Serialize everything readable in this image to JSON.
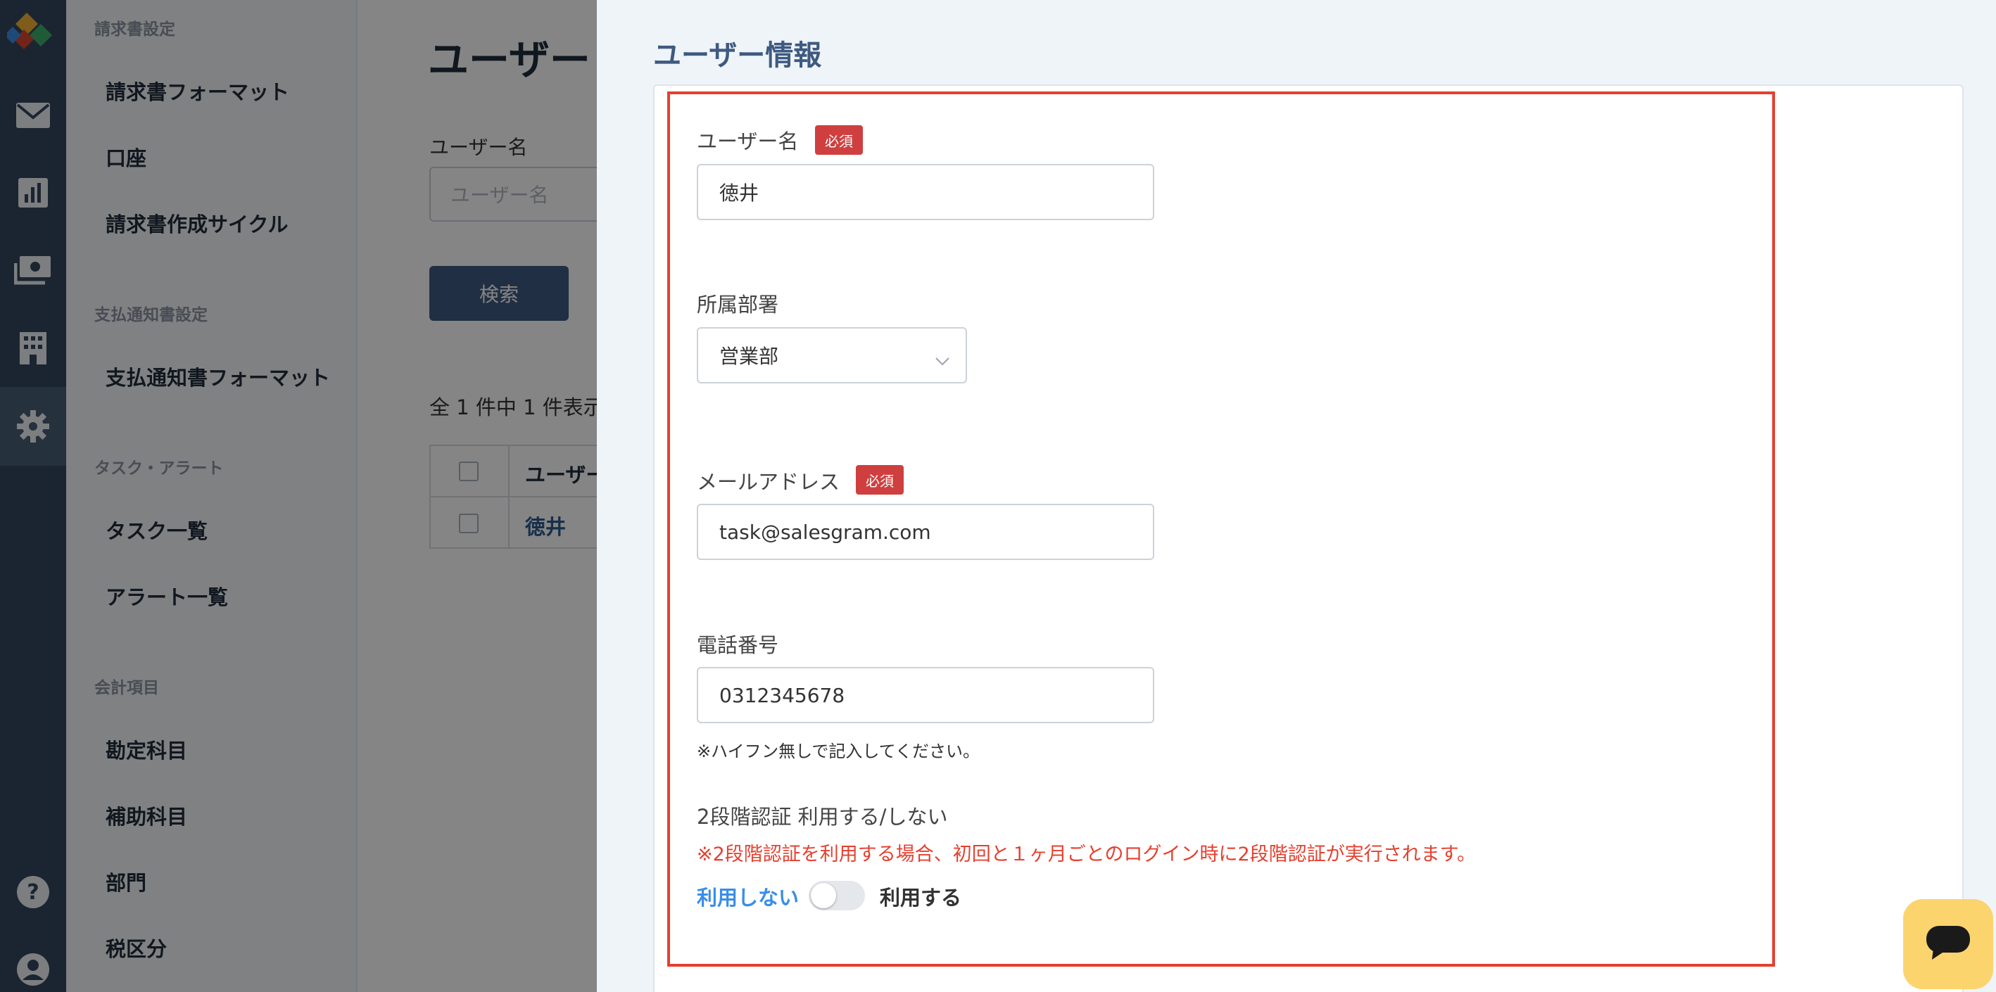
{
  "rail": {
    "icons": [
      "logo-icon",
      "mail-icon",
      "chart-icon",
      "payment-icon",
      "building-icon",
      "gear-icon",
      "help-icon",
      "user-icon"
    ],
    "colors": {
      "background": "#34485f",
      "active": "#4a5f78"
    }
  },
  "menu": {
    "sections": [
      {
        "title": "請求書設定",
        "items": [
          "請求書フォーマット",
          "口座",
          "請求書作成サイクル"
        ]
      },
      {
        "title": "支払通知書設定",
        "items": [
          "支払通知書フォーマット"
        ]
      },
      {
        "title": "タスク・アラート",
        "items": [
          "タスク一覧",
          "アラート一覧"
        ]
      },
      {
        "title": "会計項目",
        "items": [
          "勘定科目",
          "補助科目",
          "部門",
          "税区分"
        ]
      }
    ]
  },
  "main": {
    "title": "ユーザー",
    "search_label": "ユーザー名",
    "search_placeholder": "ユーザー名",
    "search_button": "検索",
    "count_text": "全 1 件中 1 件表示し",
    "table": {
      "header": "ユーザー",
      "rows": [
        "徳井"
      ]
    }
  },
  "drawer": {
    "title": "ユーザー情報",
    "required_badge": "必須",
    "fields": {
      "username": {
        "label": "ユーザー名",
        "value": "徳井"
      },
      "department": {
        "label": "所属部署",
        "value": "営業部"
      },
      "email": {
        "label": "メールアドレス",
        "value": "task@salesgram.com"
      },
      "phone": {
        "label": "電話番号",
        "value": "0312345678",
        "note": "※ハイフン無しで記入してください。"
      }
    },
    "two_factor": {
      "label": "2段階認証 利用する/しない",
      "warning": "※2段階認証を利用する場合、初回と１ヶ月ごとのログイン時に2段階認証が実行されます。",
      "off_label": "利用しない",
      "on_label": "利用する",
      "enabled": false
    },
    "colors": {
      "title": "#3e5a80",
      "badge": "#cf3f3f",
      "highlight_border": "#e5402f",
      "warning_text": "#e5402f",
      "off_label": "#3a8ee6"
    }
  },
  "chat": {
    "icon": "chat-icon",
    "color": "#fbd46d"
  }
}
